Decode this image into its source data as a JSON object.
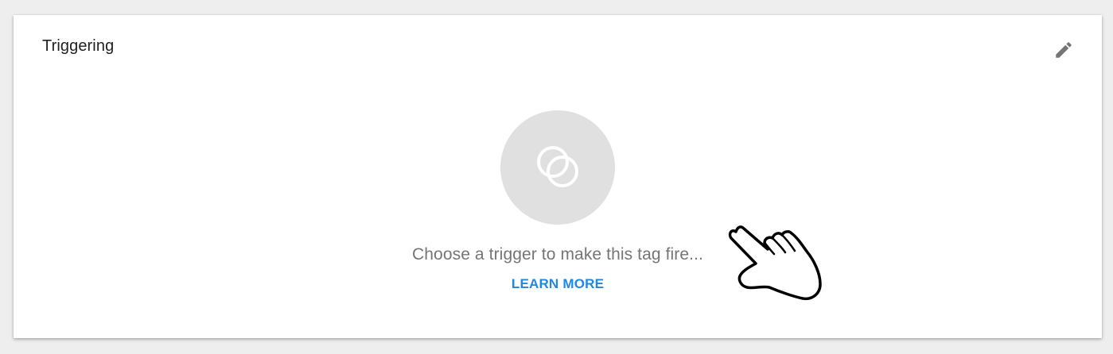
{
  "card": {
    "title": "Triggering",
    "edit_icon": "pencil-icon"
  },
  "empty_state": {
    "icon": "trigger-circles-icon",
    "hint": "Choose a trigger to make this tag fire...",
    "learn_more": "LEARN MORE"
  },
  "cursor": {
    "icon": "pointing-hand-cursor-icon"
  },
  "colors": {
    "link": "#1e88e5",
    "circle_bg": "#e0e0e0",
    "hint_text": "#757575",
    "icon_gray": "#757575"
  }
}
